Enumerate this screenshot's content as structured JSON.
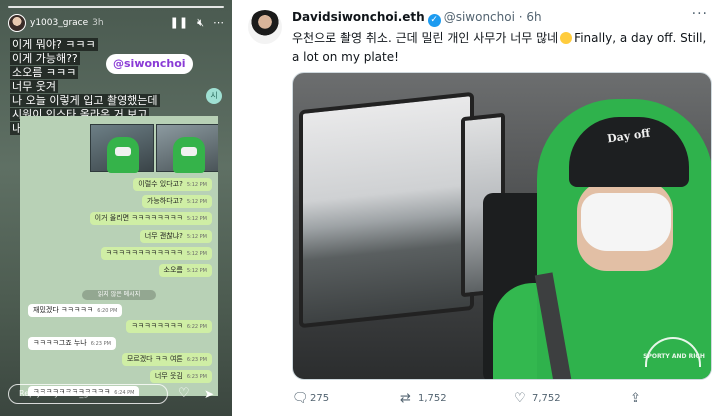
{
  "story": {
    "username": "y1003_grace",
    "time": "3h",
    "caption_lines": [
      "이게 뭐야? ㅋㅋㅋ",
      "이게 가능해??",
      "소오름 ㅋㅋㅋ",
      "너무 웃겨",
      "나 오늘 이렇게 입고 촬영했는데",
      "시원이 인스타 올라온 거 보고",
      "내가 올린줄 ..."
    ],
    "mention_tag": "@siwonchoi",
    "badge": "시",
    "chat": [
      {
        "side": "r",
        "text": "이럴수 있다고?",
        "time": "5:12 PM"
      },
      {
        "side": "r",
        "text": "가능하다고?",
        "time": "5:12 PM"
      },
      {
        "side": "r",
        "text": "이거 올리면 ㅋㅋㅋㅋㅋㅋㅋㅋ",
        "time": "5:12 PM"
      },
      {
        "side": "r",
        "text": "너무 괜찮냐?",
        "time": "5:12 PM"
      },
      {
        "side": "r",
        "text": "ㅋㅋㅋㅋㅋㅋㅋㅋㅋㅋㅋㅋ",
        "time": "5:12 PM"
      },
      {
        "side": "r",
        "text": "소오름",
        "time": "5:12 PM"
      },
      {
        "side": "l",
        "text": "재밌겠다 ㅋㅋㅋㅋㅋ",
        "time": "6:20 PM"
      },
      {
        "side": "r",
        "text": "ㅋㅋㅋㅋㅋㅋㅋㅋ",
        "time": "6:22 PM"
      },
      {
        "side": "l",
        "text": "ㅋㅋㅋㅋ그죠 누나",
        "time": "6:23 PM"
      },
      {
        "side": "r",
        "text": "모르겠다 ㅋㅋ 여튼",
        "time": "6:23 PM"
      },
      {
        "side": "r",
        "text": "너무 웃김",
        "time": "6:23 PM"
      },
      {
        "side": "l",
        "text": "ㅋㅋㅋㅋㅋㅋㅋㅋㅋㅋㅋㅋ",
        "time": "6:24 PM"
      },
      {
        "side": "l",
        "text": "재밌어",
        "time": "6:24 PM"
      }
    ],
    "unread_divider": "읽지 않은 메시지",
    "reply_placeholder": "Reply to y1003_grace"
  },
  "tweet": {
    "display_name": "Davidsiwonchoi.eth",
    "handle": "@siwonchoi",
    "time": "6h",
    "text_ko": "우천으로 촬영 취소. 근데 밀린 개인 사무가 너무 많네",
    "text_en": "Finally, a day off. Still, a lot on my plate!",
    "cap_text": "Day off",
    "hoodie_logo_text": "SPORTY AND RICH",
    "replies": "275",
    "retweets": "1,752",
    "likes": "7,752"
  },
  "colors": {
    "verified": "#1d9bf0",
    "tag_text": "#8a3bd6",
    "chat_bg": "#b8d1b6",
    "hoodie": "#2fb24c"
  },
  "icons": [
    "more-icon",
    "verified-badge-icon",
    "reply-icon",
    "retweet-icon",
    "like-icon",
    "share-icon",
    "pause-icon",
    "mute-icon",
    "heart-icon",
    "send-icon"
  ]
}
